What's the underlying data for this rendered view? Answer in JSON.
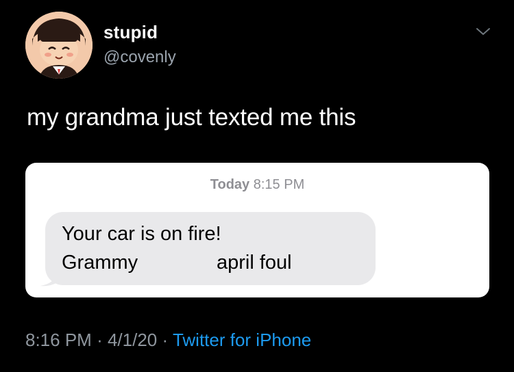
{
  "tweet": {
    "display_name": "stupid",
    "handle": "@covenly",
    "text": "my grandma just texted me this",
    "time": "8:16 PM",
    "separator": "·",
    "date": "4/1/20",
    "source": "Twitter for iPhone"
  },
  "embedded_screenshot": {
    "timestamp_day": "Today",
    "timestamp_time": "8:15 PM",
    "message_line1": "Your car is on fire!",
    "message_signature": "Grammy",
    "message_extra": "april foul"
  },
  "icons": {
    "menu": "chevron-down-icon",
    "avatar": "animal-crossing-character-avatar"
  },
  "colors": {
    "background": "#000000",
    "accent": "#1d9bf0",
    "secondary_text": "#8f969e",
    "bubble": "#e9e9eb"
  }
}
